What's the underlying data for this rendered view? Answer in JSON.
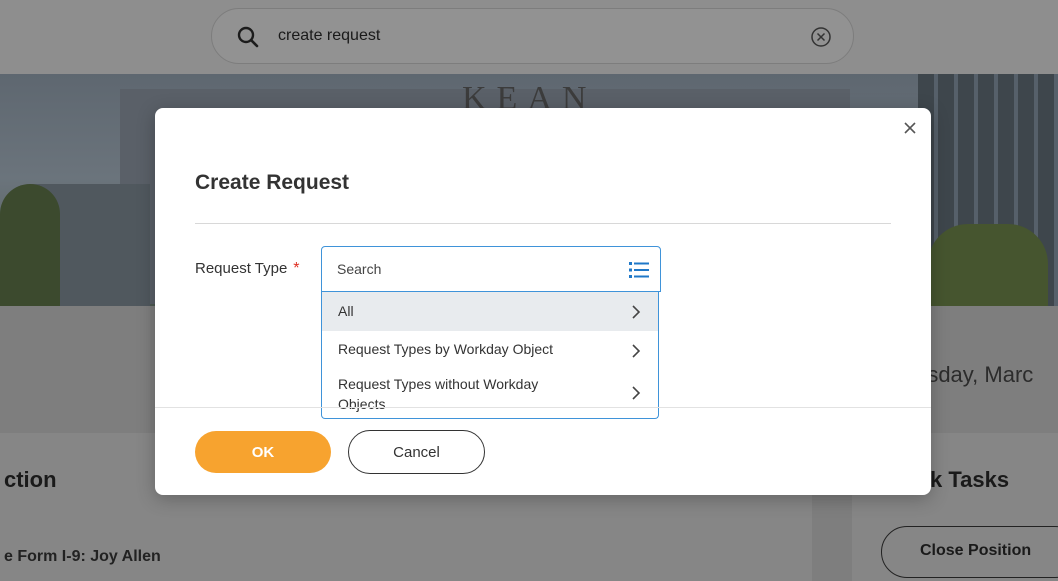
{
  "top_search": {
    "query": "create request"
  },
  "hero": {
    "building_sign": "KEAN"
  },
  "background": {
    "date_text": "rsday, Marc",
    "left_section_title": "ction",
    "right_section_title": "k Tasks",
    "task_item": "e Form I-9: Joy Allen",
    "close_position_label": "Close Position"
  },
  "modal": {
    "title": "Create Request",
    "field": {
      "label": "Request Type",
      "required_marker": "*"
    },
    "prompt": {
      "placeholder": "Search",
      "value": ""
    },
    "options": [
      {
        "label": "All"
      },
      {
        "label": "Request Types by Workday Object"
      },
      {
        "label": "Request Types without Workday Objects"
      }
    ],
    "ok_label": "OK",
    "cancel_label": "Cancel"
  },
  "colors": {
    "primary_button": "#f7a32f",
    "focus_border": "#3f93d9",
    "required_marker": "#de2e21",
    "active_option": "#e8ebee"
  },
  "icons": [
    "search-icon",
    "clear-icon",
    "close-icon",
    "list-icon",
    "chevron-right-icon"
  ]
}
